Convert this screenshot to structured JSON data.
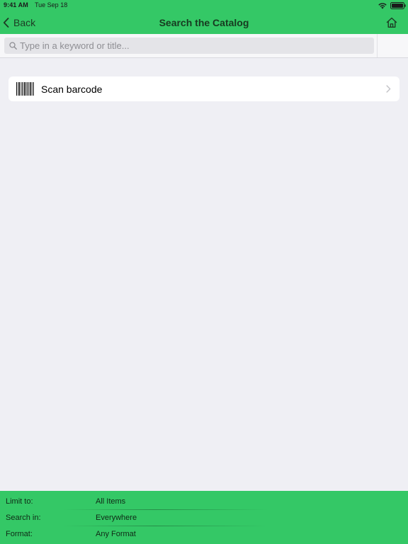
{
  "status_bar": {
    "time": "9:41 AM",
    "date": "Tue Sep 18"
  },
  "nav": {
    "back_label": "Back",
    "title": "Search the Catalog",
    "home_icon": "home-icon"
  },
  "search": {
    "placeholder": "Type in a keyword or title...",
    "value": ""
  },
  "scan": {
    "label": "Scan barcode",
    "icon": "barcode-icon"
  },
  "filters": [
    {
      "label": "Limit to:",
      "value": "All Items"
    },
    {
      "label": "Search in:",
      "value": "Everywhere"
    },
    {
      "label": "Format:",
      "value": "Any Format"
    }
  ],
  "colors": {
    "accent_green": "#34c866",
    "background": "#efeff4",
    "row_background": "#ffffff"
  }
}
